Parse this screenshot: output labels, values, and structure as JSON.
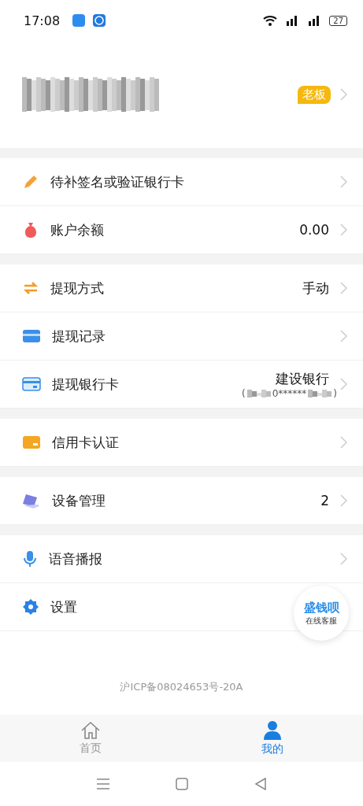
{
  "status_bar": {
    "time": "17:08",
    "battery": "27"
  },
  "profile": {
    "badge": "老板"
  },
  "groups": [
    {
      "items": [
        {
          "kind": "plain",
          "label": "待补签名或验证银行卡"
        },
        {
          "kind": "value",
          "label": "账户余额",
          "value": "0.00"
        }
      ]
    },
    {
      "items": [
        {
          "kind": "value",
          "label": "提现方式",
          "value": "手动"
        },
        {
          "kind": "plain",
          "label": "提现记录"
        },
        {
          "kind": "card",
          "label": "提现银行卡",
          "value": "建设银行",
          "open": "(",
          "masked": "0******",
          "close": ")"
        }
      ]
    },
    {
      "items": [
        {
          "kind": "plain",
          "label": "信用卡认证"
        }
      ]
    },
    {
      "items": [
        {
          "kind": "value",
          "label": "设备管理",
          "value": "2"
        }
      ]
    },
    {
      "items": [
        {
          "kind": "plain",
          "label": "语音播报"
        },
        {
          "kind": "covered",
          "label": "设置"
        }
      ]
    }
  ],
  "support_button": {
    "title": "盛钱呗",
    "subtitle": "在线客服"
  },
  "footer": {
    "icp": "沪ICP备08024653号-20A"
  },
  "tabs": [
    {
      "label": "首页",
      "selected": false
    },
    {
      "label": "我的",
      "selected": true
    }
  ]
}
